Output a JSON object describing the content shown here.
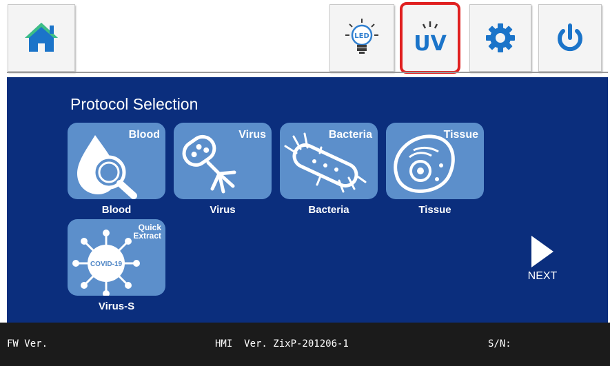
{
  "toolbar": {
    "home_icon": "home-icon",
    "led_icon": "led-bulb-icon",
    "led_label": "LED",
    "uv_icon": "uv-icon",
    "uv_label": "UV",
    "settings_icon": "gear-icon",
    "power_icon": "power-icon",
    "uv_highlight_color": "#e02020"
  },
  "main": {
    "title": "Protocol Selection",
    "tiles": [
      {
        "tag": "Blood",
        "label": "Blood",
        "icon": "blood-drop-magnifier-icon"
      },
      {
        "tag": "Virus",
        "label": "Virus",
        "icon": "virus-phage-icon"
      },
      {
        "tag": "Bacteria",
        "label": "Bacteria",
        "icon": "bacteria-icon"
      },
      {
        "tag": "Tissue",
        "label": "Tissue",
        "icon": "cell-icon"
      },
      {
        "tag_line1": "Quick",
        "tag_line2": "Extract",
        "badge": "COVID-19",
        "label": "Virus-S",
        "icon": "covid-icon"
      }
    ],
    "next_label": "NEXT",
    "background_color": "#0b2e7d",
    "tile_color": "#5c8fcb"
  },
  "status": {
    "fw": "FW Ver.",
    "hmi": "HMI  Ver. ZixP-201206-1",
    "sn": "S/N:"
  }
}
